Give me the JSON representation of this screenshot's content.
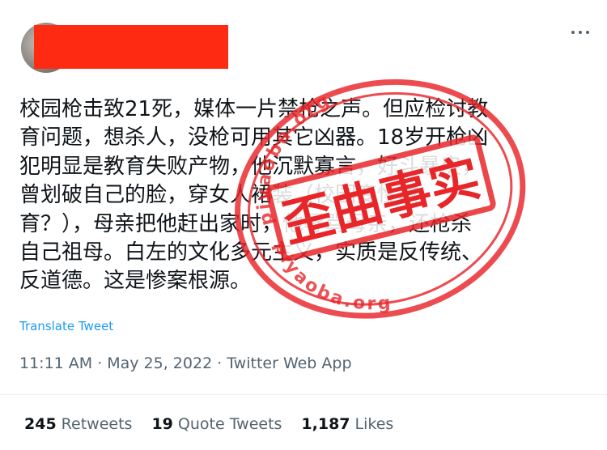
{
  "tweet": {
    "lines": [
      "校园枪击致21死，媒体一片禁枪之声。但应检讨教",
      "育问题，想杀人，没枪可用其它凶器。18岁开枪凶",
      "犯明显是教育失败产物，他沉默寡言，好斗暴戾，",
      "曾划破自己的脸，穿女人裙装（校园变性教",
      "育？），母亲把他赶出家时，他辱骂母亲，还枪杀",
      "自己祖母。白左的文化多元主义，实质是反传统、",
      "反道德。这是惨案根源。"
    ],
    "translate_label": "Translate Tweet",
    "time": "11:11 AM",
    "date": "May 25, 2022",
    "source": "Twitter Web App",
    "separator": "·"
  },
  "stats": {
    "retweets_count": "245",
    "retweets_label": "Retweets",
    "quotes_count": "19",
    "quotes_label": "Quote Tweets",
    "likes_count": "1,187",
    "likes_label": "Likes"
  },
  "stamp": {
    "text": "歪曲事实",
    "watermark": "piyaoba.org",
    "color": "#e8262a"
  },
  "icons": {
    "more": "more-horizontal-icon"
  }
}
